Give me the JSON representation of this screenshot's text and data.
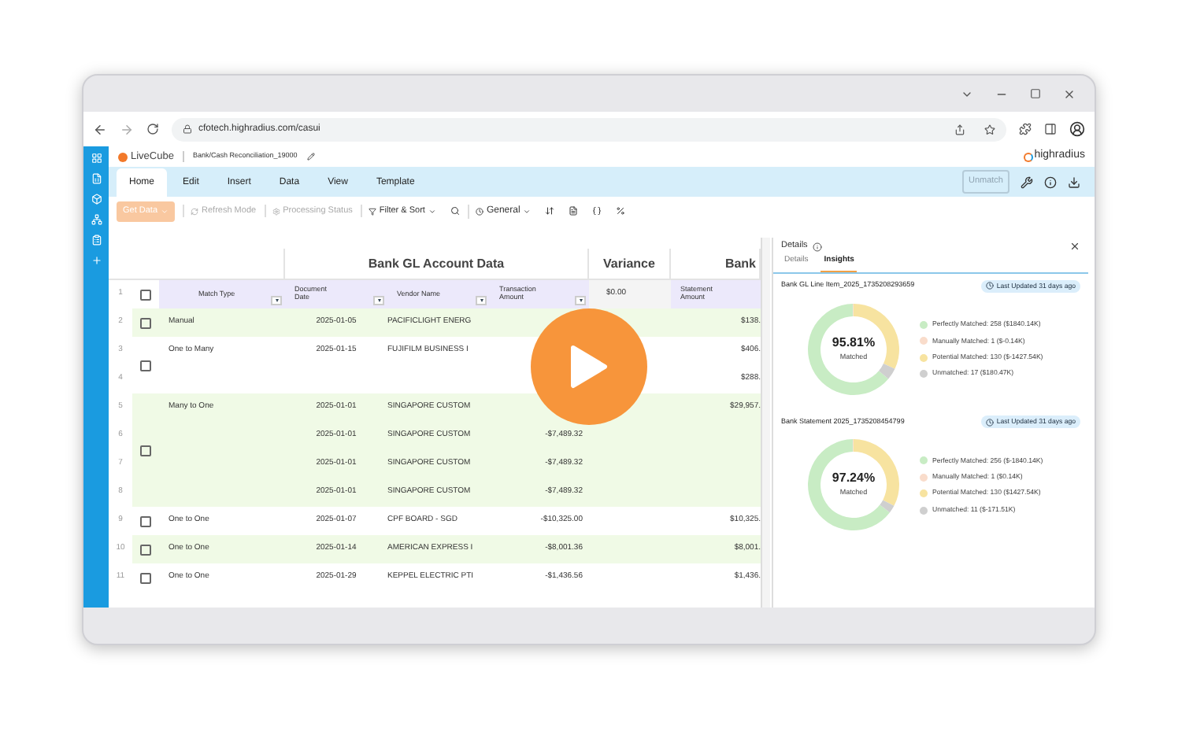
{
  "browser": {
    "url": "cfotech.highradius.com/casui"
  },
  "app": {
    "product": "LiveCube",
    "file": "Bank/Cash Reconciliation_19000",
    "brand": "highradius"
  },
  "ribbon_tabs": [
    {
      "label": "Home",
      "selected": true
    },
    {
      "label": "Edit",
      "selected": false
    },
    {
      "label": "Insert",
      "selected": false
    },
    {
      "label": "Data",
      "selected": false
    },
    {
      "label": "View",
      "selected": false
    },
    {
      "label": "Template",
      "selected": false
    }
  ],
  "unmatch_button": {
    "label": "Unmatch",
    "disabled": true
  },
  "toolbar": {
    "get_data": {
      "label": "Get Data",
      "disabled": true
    },
    "refresh_mode": {
      "label": "Refresh Mode",
      "disabled": true
    },
    "processing_status": {
      "label": "Processing Status",
      "disabled": true
    },
    "filter_sort": {
      "label": "Filter & Sort",
      "disabled": false
    },
    "view_select": {
      "value": "General"
    }
  },
  "table": {
    "group_headers": [
      "Bank GL Account Data",
      "Variance",
      "Bank"
    ],
    "header_row": "1",
    "select_all_checked": false,
    "columns": [
      {
        "label": "Match Type",
        "filter": true
      },
      {
        "label": "Document Date",
        "filter": true
      },
      {
        "label": "Vendor Name",
        "filter": true
      },
      {
        "label": "Transaction Amount",
        "filter": true
      },
      {
        "label": "$0.00",
        "filter": false
      },
      {
        "label": "Statement Amount",
        "filter": false
      }
    ],
    "groups": [
      {
        "checked": false,
        "highlighted": true,
        "match_type": "Manual",
        "rows": [
          {
            "num": "2",
            "date": "2025-01-05",
            "vendor": "PACIFICLIGHT ENERG",
            "statement": "$138."
          }
        ]
      },
      {
        "checked": false,
        "highlighted": false,
        "match_type": "One to Many",
        "rows": [
          {
            "num": "3",
            "date": "2025-01-15",
            "vendor": "FUJIFILM BUSINESS I",
            "statement": "$406."
          },
          {
            "num": "4",
            "statement": "$288."
          }
        ]
      },
      {
        "checked": false,
        "highlighted": true,
        "match_type": "Many to One",
        "rows": [
          {
            "num": "5",
            "date": "2025-01-01",
            "vendor": "SINGAPORE CUSTOM",
            "statement": "$29,957."
          },
          {
            "num": "6",
            "date": "2025-01-01",
            "vendor": "SINGAPORE CUSTOM",
            "amount": "-$7,489.32"
          },
          {
            "num": "7",
            "date": "2025-01-01",
            "vendor": "SINGAPORE CUSTOM",
            "amount": "-$7,489.32"
          },
          {
            "num": "8",
            "date": "2025-01-01",
            "vendor": "SINGAPORE CUSTOM",
            "amount": "-$7,489.32"
          }
        ]
      },
      {
        "checked": false,
        "highlighted": false,
        "match_type": "One to One",
        "rows": [
          {
            "num": "9",
            "date": "2025-01-07",
            "vendor": "CPF BOARD - SGD",
            "amount": "-$10,325.00",
            "statement": "$10,325."
          }
        ]
      },
      {
        "checked": false,
        "highlighted": true,
        "match_type": "One to One",
        "rows": [
          {
            "num": "10",
            "date": "2025-01-14",
            "vendor": "AMERICAN EXPRESS I",
            "amount": "-$8,001.36",
            "statement": "$8,001."
          }
        ]
      },
      {
        "checked": false,
        "highlighted": false,
        "match_type": "One to One",
        "rows": [
          {
            "num": "11",
            "date": "2025-01-29",
            "vendor": "KEPPEL ELECTRIC PTI",
            "amount": "-$1,436.56",
            "statement": "$1,436."
          }
        ]
      }
    ]
  },
  "panel": {
    "title": "Details",
    "tabs": [
      {
        "label": "Details",
        "selected": false
      },
      {
        "label": "Insights",
        "selected": true
      }
    ],
    "sections": [
      {
        "title": "Bank GL Line Item_2025_1735208293659",
        "badge": "Last Updated 31 days ago",
        "center_value": "95.81%",
        "center_label": "Matched",
        "legend": [
          {
            "detail": ": 258 ($1840.14K)",
            "color": "#c8ecc4"
          },
          {
            "detail": ": 1 ($-0.14K)",
            "color": "#f9dccb"
          },
          {
            "detail": ": 130 ($-1427.54K)",
            "color": "#f7e3a0"
          },
          {
            "detail": ": 17 ($180.47K)",
            "color": "#cfcfcf"
          }
        ],
        "chart_data": {
          "type": "donut",
          "categories": [
            "Perfectly Matched",
            "Manually Matched",
            "Potential Matched",
            "Unmatched"
          ],
          "values": [
            63.54,
            0.25,
            32.02,
            4.19
          ]
        }
      },
      {
        "title": "Bank Statement 2025_1735208454799",
        "badge": "Last Updated 31 days ago",
        "center_value": "97.24%",
        "center_label": "Matched",
        "legend": [
          {
            "detail": ": 256 ($-1840.14K)",
            "color": "#c8ecc4"
          },
          {
            "detail": ": 1 ($0.14K)",
            "color": "#f9dccb"
          },
          {
            "detail": ": 130 ($1427.54K)",
            "color": "#f7e3a0"
          },
          {
            "detail": ": 11 ($-171.51K)",
            "color": "#cfcfcf"
          }
        ],
        "chart_data": {
          "type": "donut",
          "categories": [
            "Perfectly Matched",
            "Manually Matched",
            "Potential Matched",
            "Unmatched"
          ],
          "values": [
            64.33,
            0.25,
            32.66,
            2.76
          ]
        }
      }
    ]
  }
}
